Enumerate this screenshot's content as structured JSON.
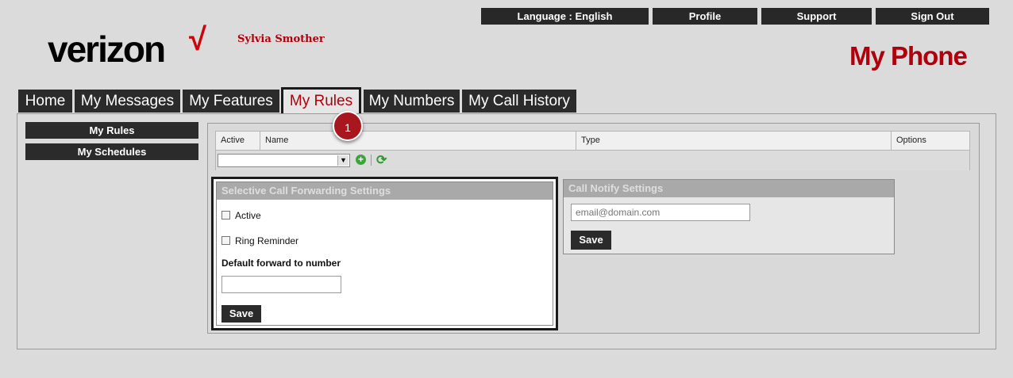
{
  "header": {
    "top_buttons": [
      "Language : English",
      "Profile",
      "Support",
      "Sign Out"
    ],
    "logo_text": "verizon",
    "logo_check": "√",
    "username": "Sylvia Smother",
    "app_title": "My Phone"
  },
  "tabs": {
    "items": [
      "Home",
      "My Messages",
      "My Features",
      "My Rules",
      "My Numbers",
      "My Call History"
    ],
    "active": "My Rules"
  },
  "sidebar": {
    "items": [
      "My Rules",
      "My Schedules"
    ]
  },
  "rules_grid": {
    "columns": [
      "Active",
      "Name",
      "Type",
      "Options"
    ],
    "select_value": "",
    "add_icon": "plus-circle-icon",
    "refresh_icon": "refresh-icon"
  },
  "selective_call_forwarding": {
    "title": "Selective Call Forwarding Settings",
    "active_label": "Active",
    "active_checked": false,
    "ring_reminder_label": "Ring Reminder",
    "ring_reminder_checked": false,
    "forward_label": "Default forward to number",
    "forward_value": "",
    "save_label": "Save"
  },
  "call_notify": {
    "title": "Call Notify Settings",
    "email_placeholder": "email@domain.com",
    "save_label": "Save"
  },
  "annotation": {
    "step": "1"
  },
  "colors": {
    "brand_red": "#b0000c",
    "dark_button": "#2b2b2b",
    "background": "#dbdbdb"
  }
}
